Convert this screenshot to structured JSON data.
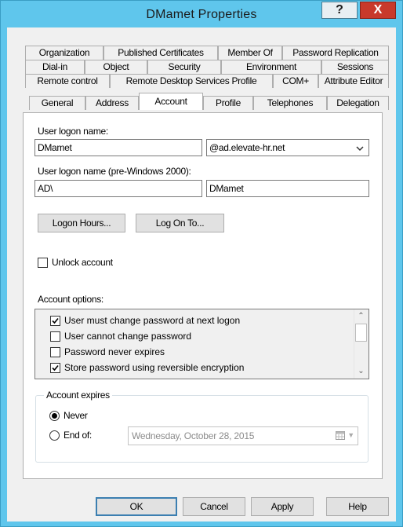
{
  "window": {
    "title": "DMamet Properties",
    "help_glyph": "?",
    "close_glyph": "X"
  },
  "tabs": {
    "row1": [
      "Organization",
      "Published Certificates",
      "Member Of",
      "Password Replication"
    ],
    "row2": [
      "Dial-in",
      "Object",
      "Security",
      "Environment",
      "Sessions"
    ],
    "row3": [
      "Remote control",
      "Remote Desktop Services Profile",
      "COM+",
      "Attribute Editor"
    ],
    "row4": [
      "General",
      "Address",
      "Account",
      "Profile",
      "Telephones",
      "Delegation"
    ],
    "selected": "Account"
  },
  "account": {
    "logon_name_label": "User logon name:",
    "logon_name_value": "DMamet",
    "domain_suffix": "@ad.elevate-hr.net",
    "pre2000_label": "User logon name (pre-Windows 2000):",
    "pre2000_domain": "AD\\",
    "pre2000_user": "DMamet",
    "logon_hours_button": "Logon Hours...",
    "log_on_to_button": "Log On To...",
    "unlock_label": "Unlock account",
    "options_label": "Account options:",
    "options": [
      {
        "label": "User must change password at next logon",
        "checked": true
      },
      {
        "label": "User cannot change password",
        "checked": false
      },
      {
        "label": "Password never expires",
        "checked": false
      },
      {
        "label": "Store password using reversible encryption",
        "checked": true
      }
    ],
    "expires_label": "Account expires",
    "never_label": "Never",
    "end_of_label": "End of:",
    "expires_selected": "never",
    "end_date": "Wednesday,  October  28, 2015"
  },
  "buttons": {
    "ok": "OK",
    "cancel": "Cancel",
    "apply": "Apply",
    "help": "Help"
  }
}
